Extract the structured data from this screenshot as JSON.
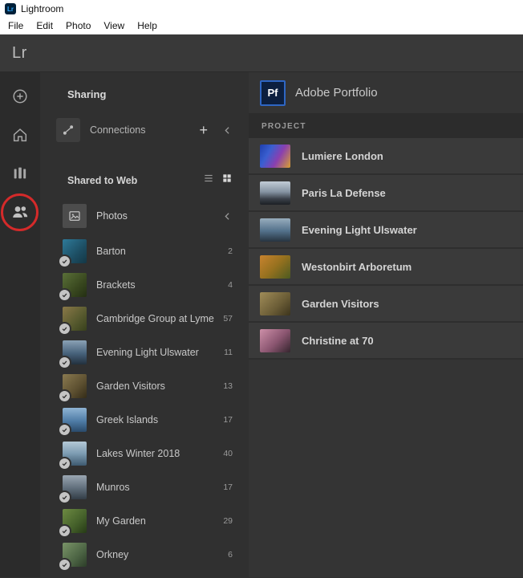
{
  "window": {
    "app_icon": "Lr",
    "title": "Lightroom",
    "menus": [
      {
        "label": "File"
      },
      {
        "label": "Edit"
      },
      {
        "label": "Photo"
      },
      {
        "label": "View"
      },
      {
        "label": "Help"
      }
    ]
  },
  "header": {
    "logo": "Lr"
  },
  "sharing": {
    "title": "Sharing",
    "connections": {
      "label": "Connections",
      "add_label": "+"
    },
    "shared_to_web": {
      "label": "Shared to Web"
    },
    "photos": {
      "label": "Photos"
    },
    "albums": [
      {
        "name": "Barton",
        "count": "2",
        "thumb": "linear-gradient(135deg,#2e7a99 0%,#1d4e63 60%,#143745 100%)"
      },
      {
        "name": "Brackets",
        "count": "4",
        "thumb": "linear-gradient(135deg,#5a7038 0%,#39481f 60%,#242f13 100%)"
      },
      {
        "name": "Cambridge Group at Lyme",
        "count": "57",
        "thumb": "linear-gradient(135deg,#8a7848 0%,#5a5c30 55%,#37401c 100%)"
      },
      {
        "name": "Evening Light Ulswater",
        "count": "11",
        "thumb": "linear-gradient(180deg,#8aa2b5 0%,#46617a 55%,#22303e 100%)"
      },
      {
        "name": "Garden Visitors",
        "count": "13",
        "thumb": "linear-gradient(135deg,#8a7a50 0%,#5c4f30 60%,#342c18 100%)"
      },
      {
        "name": "Greek Islands",
        "count": "17",
        "thumb": "linear-gradient(180deg,#8fb4d4 0%,#4f7ca6 55%,#2a4a6a 100%)"
      },
      {
        "name": "Lakes Winter 2018",
        "count": "40",
        "thumb": "linear-gradient(180deg,#b4c8d6 0%,#7d9cb2 50%,#3e5a70 100%)"
      },
      {
        "name": "Munros",
        "count": "17",
        "thumb": "linear-gradient(180deg,#9aa6b2 0%,#5f6d7a 55%,#333d46 100%)"
      },
      {
        "name": "My Garden",
        "count": "29",
        "thumb": "linear-gradient(135deg,#6d8a42 0%,#44602a 60%,#263a16 100%)"
      },
      {
        "name": "Orkney",
        "count": "6",
        "thumb": "linear-gradient(135deg,#7a9468 0%,#4c6444 60%,#2c3d28 100%)"
      }
    ]
  },
  "portfolio": {
    "logo_text": "Pf",
    "title": "Adobe Portfolio",
    "section_label": "PROJECT",
    "projects": [
      {
        "name": "Lumiere London",
        "thumb": "linear-gradient(120deg,#1e3fae 0%,#3a5fd0 30%,#8a3fb0 60%,#d8a030 100%)"
      },
      {
        "name": "Paris La Defense",
        "thumb": "linear-gradient(180deg,#c2ccd6 0%,#8593a2 45%,#3a4049 75%,#1c2025 100%)"
      },
      {
        "name": "Evening Light Ulswater",
        "thumb": "linear-gradient(180deg,#98adbd 0%,#52708a 55%,#273440 100%)"
      },
      {
        "name": "Westonbirt Arboretum",
        "thumb": "linear-gradient(135deg,#c8832e 0%,#96711f 50%,#4c5a20 100%)"
      },
      {
        "name": "Garden Visitors",
        "thumb": "linear-gradient(135deg,#a08c58 0%,#6a5c36 60%,#3c341c 100%)"
      },
      {
        "name": "Christine at 70",
        "thumb": "linear-gradient(135deg,#cd8fa8 0%,#8a5570 55%,#35252e 100%)"
      }
    ]
  },
  "colors": {
    "annotation_red": "#d42a2a",
    "portfolio_blue": "#2e66c4",
    "panel_dark": "#303030",
    "row_gray": "#3a3a3a"
  }
}
